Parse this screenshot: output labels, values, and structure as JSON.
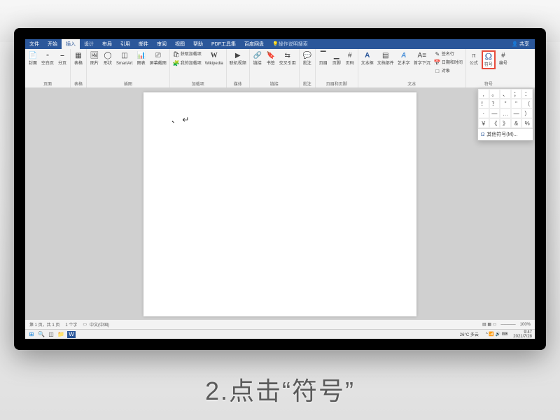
{
  "tabs": {
    "file": "文件",
    "home": "开始",
    "insert": "插入",
    "design": "设计",
    "layout": "布局",
    "references": "引用",
    "mailings": "邮件",
    "review": "审阅",
    "view": "视图",
    "help": "帮助",
    "pdf": "PDF工具集",
    "baidu": "百度网盘"
  },
  "tell_me": "操作说明搜索",
  "share": "共享",
  "ribbon": {
    "pages": {
      "label": "页面",
      "cover": "封面",
      "blank": "空白页",
      "break": "分页"
    },
    "tables": {
      "label": "表格",
      "table": "表格"
    },
    "illustrations": {
      "label": "插图",
      "pictures": "图片",
      "shapes": "形状",
      "smartart": "SmartArt",
      "chart": "图表",
      "screenshot": "屏幕截图"
    },
    "addins": {
      "label": "加载项",
      "get": "获取加载项",
      "my": "我的加载项",
      "wiki": "Wikipedia"
    },
    "media": {
      "label": "媒体",
      "video": "联机视频"
    },
    "links": {
      "label": "链接",
      "link": "链接",
      "bookmark": "书签",
      "crossref": "交叉引用"
    },
    "comments": {
      "label": "批注",
      "comment": "批注"
    },
    "headerfooter": {
      "label": "页眉和页脚",
      "header": "页眉",
      "footer": "页脚",
      "pagenum": "页码"
    },
    "text": {
      "label": "文本",
      "textbox": "文本框",
      "quickparts": "文档部件",
      "wordart": "艺术字",
      "dropcap": "首字下沉",
      "sigline": "签名行",
      "datetime": "日期和时间",
      "object": "对象"
    },
    "symbols": {
      "label": "符号",
      "equation": "公式",
      "symbol": "符号",
      "number": "编号"
    }
  },
  "symbol_popup": {
    "grid": [
      ",",
      "。",
      "、",
      "；",
      "：",
      "！",
      "？",
      "\"",
      "\"",
      "（",
      "·",
      "—",
      "…",
      "—",
      "）",
      "￥",
      "《",
      "》",
      "&",
      "%"
    ],
    "more": "其他符号(M)..."
  },
  "doc_content": "、",
  "statusbar": {
    "page": "第 1 页，共 1 页",
    "words": "1 个字",
    "lang": "中文(中国)",
    "zoom": "100%"
  },
  "taskbar": {
    "weather": "26°C 多云",
    "time": "9:47",
    "date": "2021/7/28"
  },
  "caption": "2.点击“符号”"
}
